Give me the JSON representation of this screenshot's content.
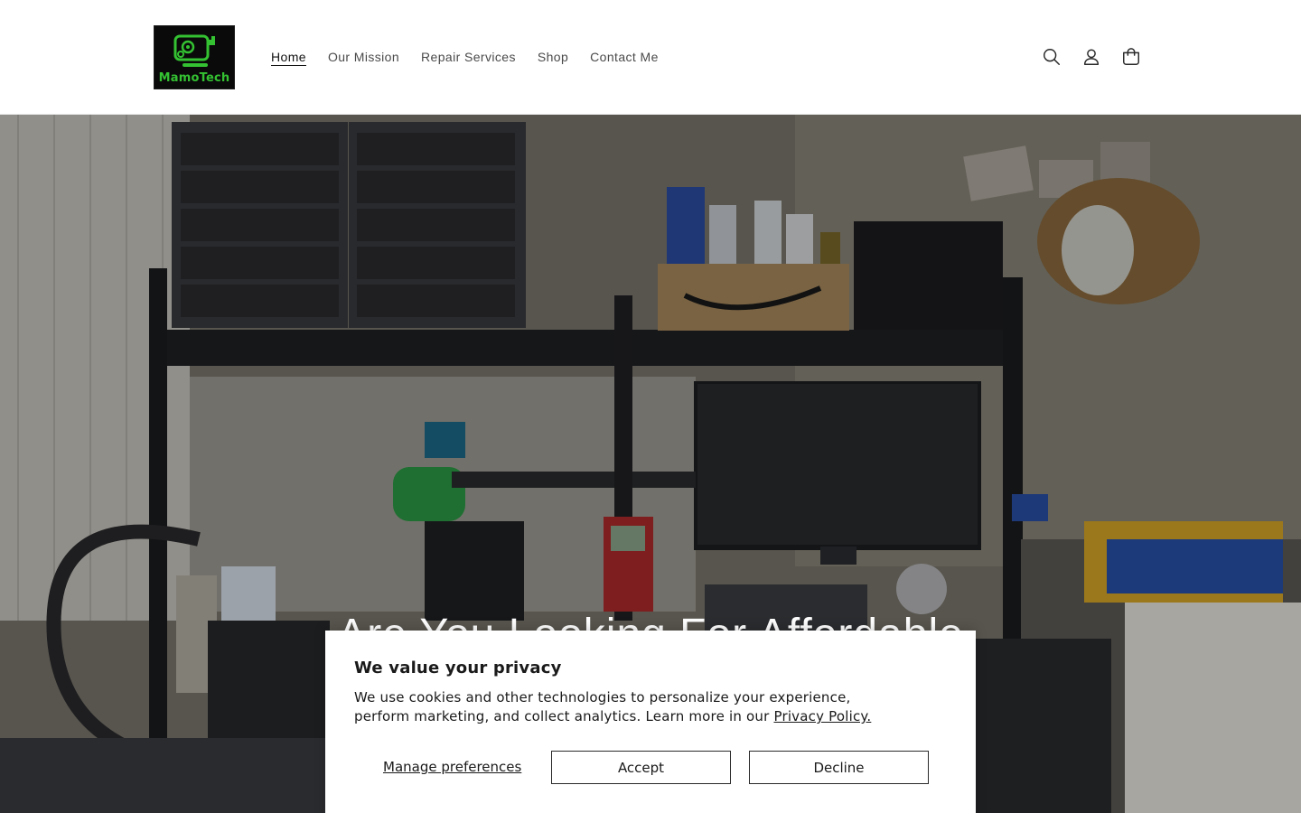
{
  "brand": {
    "name": "MamoTech",
    "text_color": "#34c232",
    "bg_color": "#0a0a0a"
  },
  "nav": {
    "items": [
      {
        "label": "Home",
        "active": true
      },
      {
        "label": "Our Mission",
        "active": false
      },
      {
        "label": "Repair Services",
        "active": false
      },
      {
        "label": "Shop",
        "active": false
      },
      {
        "label": "Contact Me",
        "active": false
      }
    ]
  },
  "header_icons": [
    "search-icon",
    "account-icon",
    "cart-icon"
  ],
  "hero": {
    "heading": "Are You Looking For Affordable"
  },
  "cookie_banner": {
    "title": "We value your privacy",
    "body": "We use cookies and other technologies to personalize your experience, perform marketing, and collect analytics. Learn more in our ",
    "link_label": "Privacy Policy.",
    "manage_label": "Manage preferences",
    "accept_label": "Accept",
    "decline_label": "Decline"
  }
}
